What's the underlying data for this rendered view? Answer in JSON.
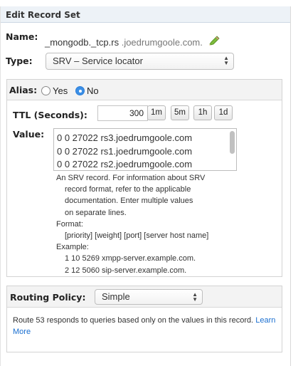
{
  "header": {
    "title": "Edit Record Set"
  },
  "name": {
    "label": "Name:",
    "prefix": "_mongodb._tcp.rs",
    "domain": ".joedrumgoole.com.",
    "edit_icon": "pencil-icon"
  },
  "type": {
    "label": "Type:",
    "selected": "SRV – Service locator"
  },
  "alias": {
    "label": "Alias:",
    "options": [
      "Yes",
      "No"
    ],
    "selected": "No"
  },
  "ttl": {
    "label": "TTL (Seconds):",
    "value": "300",
    "presets": [
      "1m",
      "5m",
      "1h",
      "1d"
    ]
  },
  "value": {
    "label": "Value:",
    "lines": [
      "0 0 27022 rs3.joedrumgoole.com",
      "0 0 27022 rs1.joedrumgoole.com",
      "0 0 27022 rs2.joedrumgoole.com"
    ],
    "help": {
      "intro_1": "An SRV record. For information about SRV",
      "intro_2": "record format, refer to the applicable",
      "intro_3": "documentation. Enter multiple values",
      "intro_4": "on separate lines.",
      "format_label": "Format:",
      "format": "[priority] [weight] [port] [server host name]",
      "example_label": "Example:",
      "example_1": "1 10 5269 xmpp-server.example.com.",
      "example_2": "2 12 5060 sip-server.example.com."
    }
  },
  "routing": {
    "label": "Routing Policy:",
    "selected": "Simple",
    "description": "Route 53 responds to queries based only on the values in this record.",
    "link_1": "Learn",
    "link_2": "More"
  },
  "colors": {
    "accent": "#3b8fe6",
    "link": "#1a6fd0",
    "header_bg": "#edf2f7"
  }
}
